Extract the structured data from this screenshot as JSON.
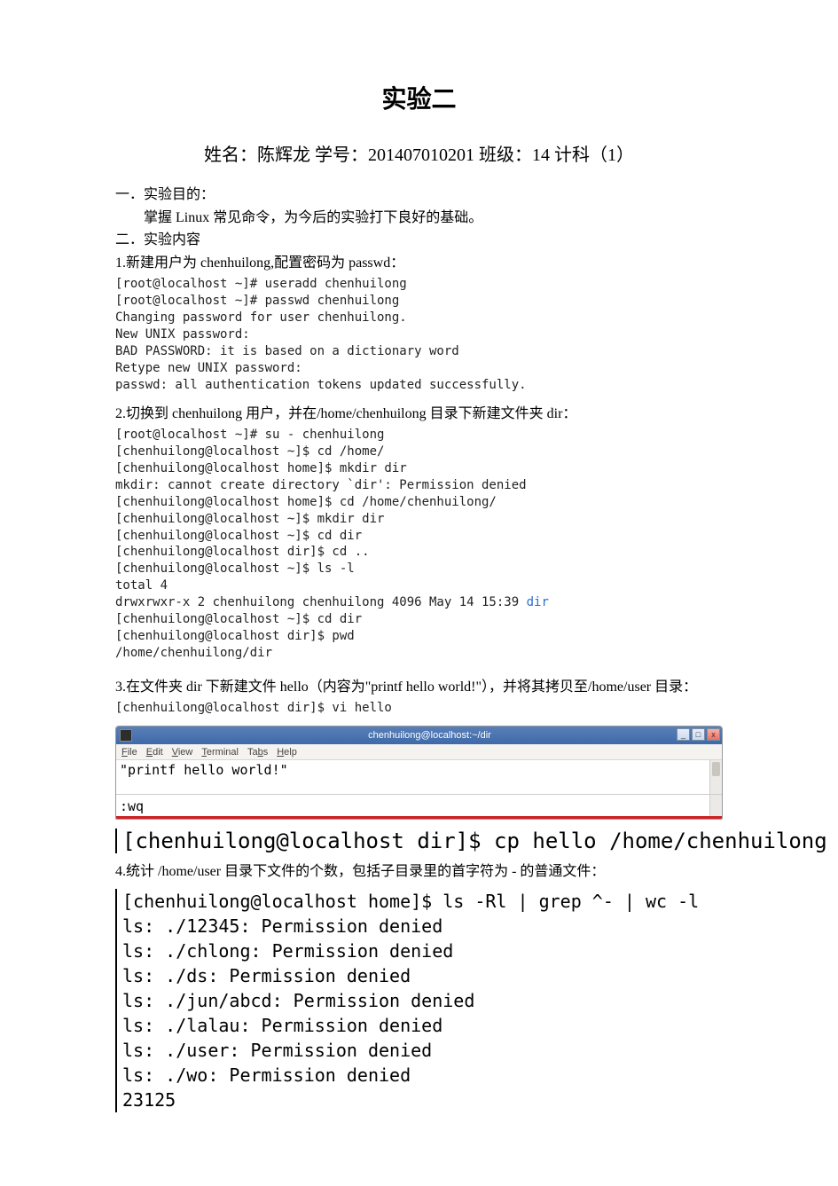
{
  "title": "实验二",
  "subtitle": "姓名：陈辉龙  学号：201407010201  班级：14 计科（1）",
  "sec1_heading": "一．实验目的：",
  "sec1_line1": "掌握 Linux 常见命令，为今后的实验打下良好的基础。",
  "sec2_heading": "二．实验内容",
  "step1_text": "1.新建用户为 chenhuilong,配置密码为 passwd：",
  "terminal1": "[root@localhost ~]# useradd chenhuilong\n[root@localhost ~]# passwd chenhuilong\nChanging password for user chenhuilong.\nNew UNIX password:\nBAD PASSWORD: it is based on a dictionary word\nRetype new UNIX password:\npasswd: all authentication tokens updated successfully.",
  "step2_text": "2.切换到 chenhuilong 用户，并在/home/chenhuilong 目录下新建文件夹 dir：",
  "terminal2a": "[root@localhost ~]# su - chenhuilong\n[chenhuilong@localhost ~]$ cd /home/\n[chenhuilong@localhost home]$ mkdir dir\nmkdir: cannot create directory `dir': Permission denied\n[chenhuilong@localhost home]$ cd /home/chenhuilong/\n[chenhuilong@localhost ~]$ mkdir dir\n[chenhuilong@localhost ~]$ cd dir\n[chenhuilong@localhost dir]$ cd ..\n[chenhuilong@localhost ~]$ ls -l\ntotal 4",
  "terminal2b_prefix": "drwxrwxr-x 2 chenhuilong chenhuilong 4096 May 14 15:39 ",
  "terminal2b_dir": "dir",
  "terminal2c": "[chenhuilong@localhost ~]$ cd dir\n[chenhuilong@localhost dir]$ pwd\n/home/chenhuilong/dir",
  "step3_text": "3.在文件夹 dir 下新建文件 hello（内容为\"printf hello world!\"），并将其拷贝至/home/user 目录：",
  "terminal3a": "[chenhuilong@localhost dir]$ vi hello",
  "term_window": {
    "title": "chenhuilong@localhost:~/dir",
    "menu": {
      "file": "File",
      "edit": "Edit",
      "view": "View",
      "terminal": "Terminal",
      "tabs": "Tabs",
      "help": "Help"
    },
    "content": "\"printf hello world!\"",
    "wq": ":wq",
    "btn_min": "_",
    "btn_max": "□",
    "btn_close": "x"
  },
  "cp_line": "[chenhuilong@localhost dir]$ cp hello /home/chenhuilong",
  "step4_text": "4.统计 /home/user 目录下文件的个数，包括子目录里的首字符为 - 的普通文件：",
  "terminal4": "[chenhuilong@localhost home]$ ls -Rl | grep ^- | wc -l\nls: ./12345: Permission denied\nls: ./chlong: Permission denied\nls: ./ds: Permission denied\nls: ./jun/abcd: Permission denied\nls: ./lalau: Permission denied\nls: ./user: Permission denied\nls: ./wo: Permission denied\n23125"
}
